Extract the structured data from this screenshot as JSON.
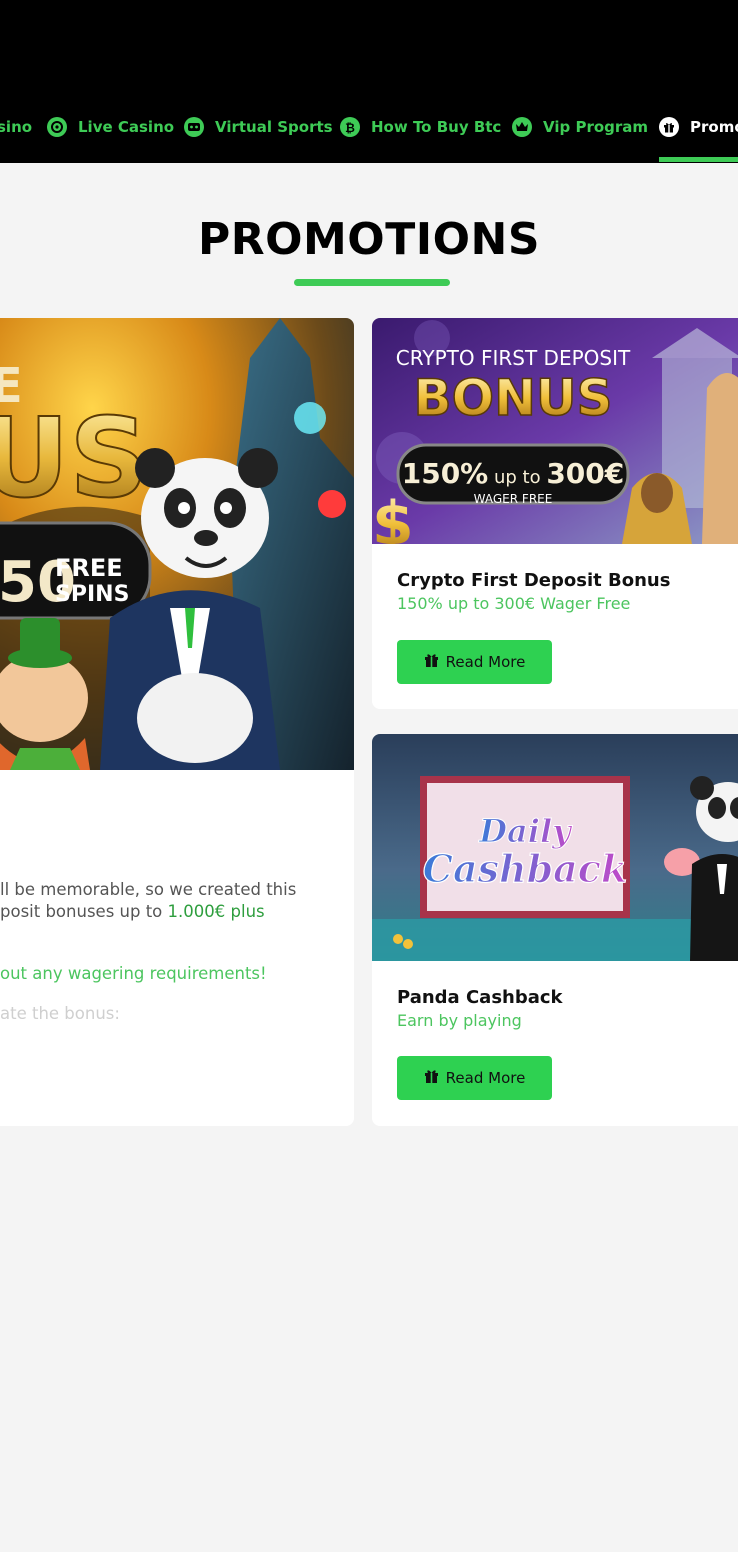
{
  "nav": {
    "items": [
      {
        "label": "sino",
        "icon": "casino-chip-icon"
      },
      {
        "label": "Live Casino",
        "icon": "roulette-icon"
      },
      {
        "label": "Virtual Sports",
        "icon": "vr-headset-icon"
      },
      {
        "label": "How To Buy Btc",
        "icon": "bitcoin-icon"
      },
      {
        "label": "Vip Program",
        "icon": "crown-icon"
      },
      {
        "label": "Promo",
        "icon": "gift-icon",
        "active": true
      }
    ]
  },
  "page": {
    "title": "PROMOTIONS"
  },
  "cards": {
    "left": {
      "banner": {
        "big_letters_1": "E",
        "big_letters_2": "US",
        "spins_number": "50",
        "spins_line1": "FREE",
        "spins_line2": "SPINS"
      },
      "desc1a": "ll be memorable, so we created this",
      "desc2a": "posit bonuses up to ",
      "desc2b": "1.000€ plus",
      "desc3": "out any wagering requirements!",
      "desc4": "ate the bonus:"
    },
    "crypto": {
      "banner": {
        "line1": "CRYPTO FIRST DEPOSIT",
        "line2": "BONUS",
        "pct": "150%",
        "upto": " up to ",
        "amount": "300€",
        "wager": "WAGER FREE"
      },
      "title": "Crypto First Deposit Bonus",
      "subtitle": "150% up to 300€ Wager Free",
      "button": "Read More"
    },
    "cashback": {
      "banner": {
        "line1": "Daily",
        "line2": "Cashback"
      },
      "title": "Panda Cashback",
      "subtitle": "Earn by playing",
      "button": "Read More"
    }
  },
  "colors": {
    "accent": "#3ecb56",
    "button": "#2ed151",
    "nav_bg": "#000000",
    "page_bg": "#f4f4f4"
  }
}
